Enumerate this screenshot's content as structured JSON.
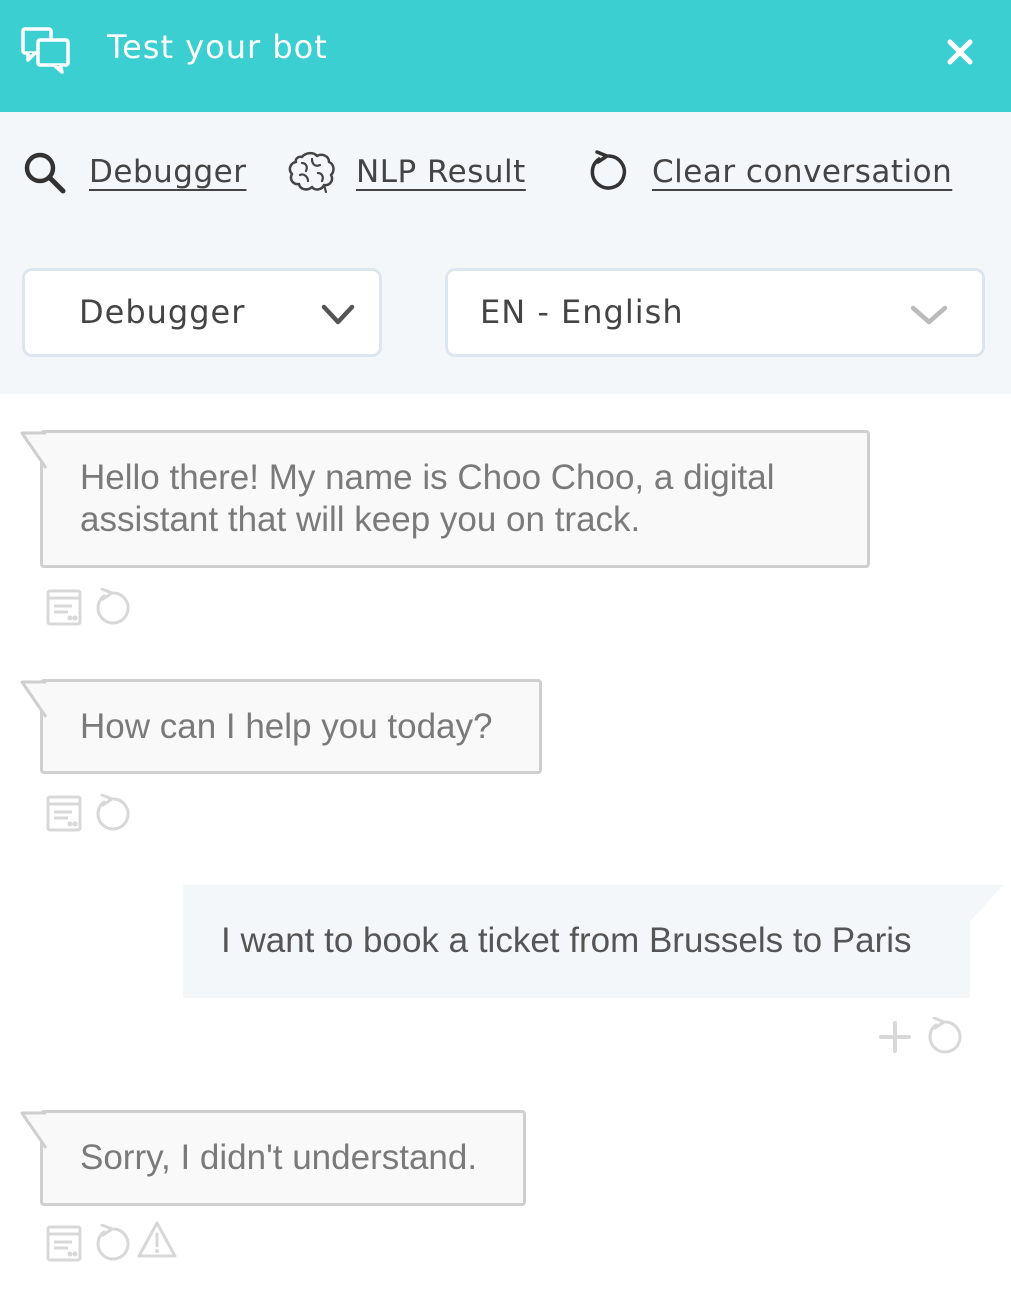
{
  "header": {
    "title": "Test your bot",
    "icon": "chat-bubbles-icon",
    "close_icon": "close-icon",
    "background": "#3ccfd2"
  },
  "toolbar": {
    "debugger_label": "Debugger",
    "nlp_label": "NLP Result",
    "clear_label": "Clear conversation",
    "icons": [
      "search-icon",
      "brain-icon",
      "refresh-icon"
    ]
  },
  "selects": {
    "mode": {
      "value": "Debugger"
    },
    "language": {
      "value": "EN - English"
    }
  },
  "messages": [
    {
      "from": "bot",
      "text": "Hello there! My name is Choo Choo, a digital assistant that will keep you on track.",
      "actions": [
        "log-icon",
        "replay-icon"
      ]
    },
    {
      "from": "bot",
      "text": "How can I help you today?",
      "actions": [
        "log-icon",
        "replay-icon"
      ]
    },
    {
      "from": "user",
      "text": "I want to book a ticket from Brussels to Paris",
      "actions": [
        "add-icon",
        "replay-icon"
      ]
    },
    {
      "from": "bot",
      "text": "Sorry, I didn't understand.",
      "actions": [
        "log-icon",
        "replay-icon",
        "warning-icon"
      ]
    }
  ]
}
